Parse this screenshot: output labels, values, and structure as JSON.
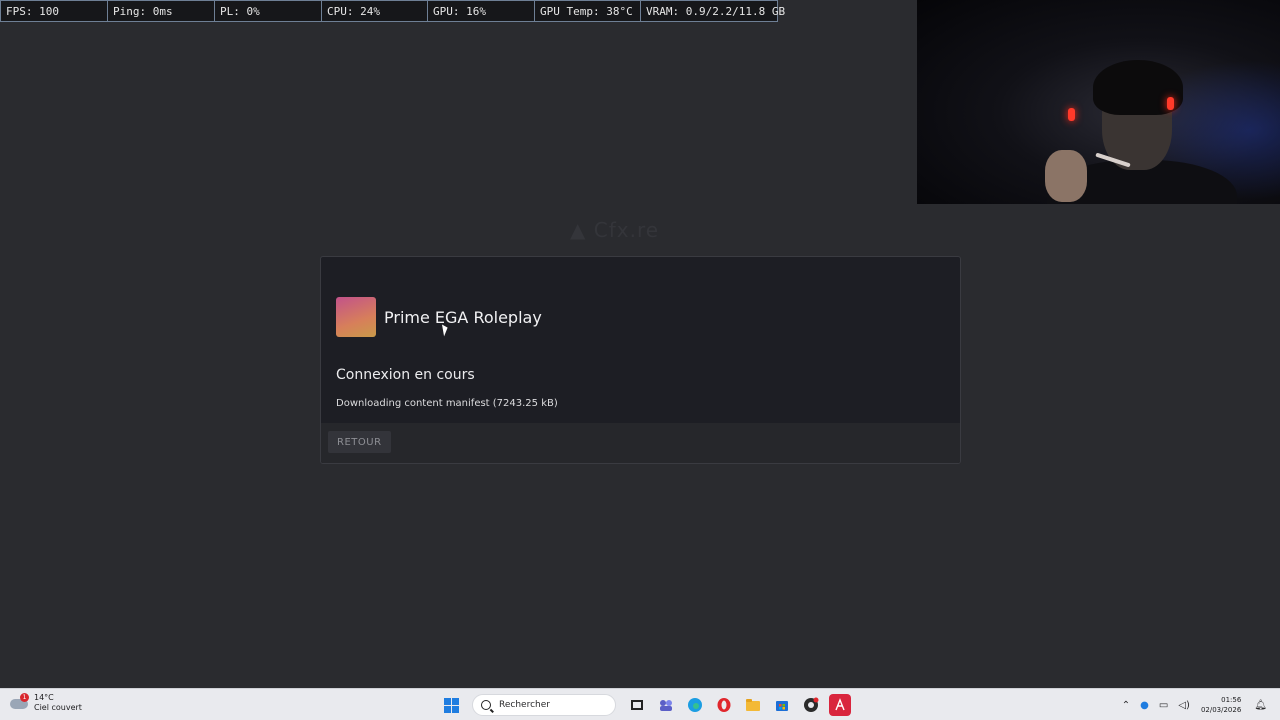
{
  "perf_overlay": {
    "fps": "FPS: 100",
    "ping": "Ping: 0ms",
    "pl": "PL: 0%",
    "cpu": "CPU: 24%",
    "gpu": "GPU: 16%",
    "gpu_temp": "GPU Temp: 38°C",
    "vram": "VRAM: 0.9/2.2/11.8 GB"
  },
  "background": {
    "logo_text": "Cfx.re"
  },
  "dialog": {
    "server_name": "Prime EGA Roleplay",
    "status_title": "Connexion en cours",
    "status_detail": "Downloading content manifest (7243.25 kB)",
    "back_label": "RETOUR"
  },
  "taskbar": {
    "weather": {
      "temperature": "14°C",
      "condition": "Ciel couvert",
      "badge": "1"
    },
    "search_placeholder": "Rechercher",
    "pinned_icons": [
      "start-icon",
      "search-icon",
      "task-view-icon",
      "teams-icon",
      "edge-icon",
      "opera-icon",
      "file-explorer-icon",
      "store-icon",
      "obs-icon",
      "app-icon"
    ],
    "clock": {
      "time": "01:56",
      "date": "02/03/2026"
    }
  },
  "colors": {
    "perf_border": "#6e7f95",
    "dialog_bg": "#1d1e24",
    "page_bg": "#2a2b2f",
    "start_blue": "#1f7de0"
  }
}
